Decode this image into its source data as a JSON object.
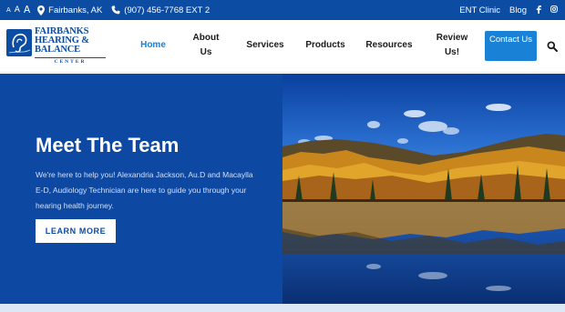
{
  "topbar": {
    "font_sizes": [
      "A",
      "A",
      "A"
    ],
    "location": "Fairbanks, AK",
    "phone": "(907) 456-7768 EXT 2",
    "links": [
      "ENT Clinic",
      "Blog"
    ],
    "social_icons": [
      "facebook-icon",
      "instagram-icon"
    ]
  },
  "logo": {
    "line1": "FAIRBANKS",
    "line2": "HEARING &",
    "line3": "BALANCE",
    "line4": "CENTER"
  },
  "nav": {
    "items": [
      {
        "label": "Home",
        "active": true
      },
      {
        "label": "About Us"
      },
      {
        "label": "Services"
      },
      {
        "label": "Products"
      },
      {
        "label": "Resources"
      },
      {
        "label": "Review Us!"
      }
    ],
    "contact": "Contact Us"
  },
  "hero": {
    "title": "Meet The Team",
    "text": "We're here to help you! Alexandria Jackson, Au.D and Macaylla E-D, Audiology Technician are here to guide you through your hearing health journey.",
    "button": "LEARN MORE"
  },
  "colors": {
    "primary": "#0d4ca3",
    "accent": "#1a82d6",
    "hero_bg": "#0d48a2"
  }
}
